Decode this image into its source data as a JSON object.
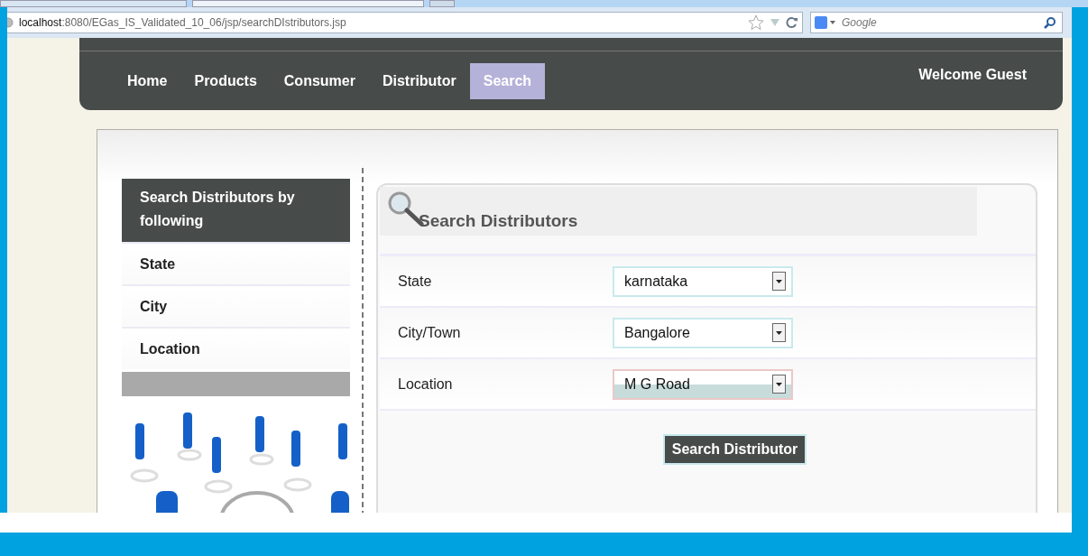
{
  "browser": {
    "url_host": "localhost",
    "url_path": ":8080/EGas_IS_Validated_10_06/jsp/searchDIstributors.jsp",
    "search_placeholder": "Google"
  },
  "nav": {
    "items": [
      {
        "label": "Home",
        "selected": false
      },
      {
        "label": "Products",
        "selected": false
      },
      {
        "label": "Consumer",
        "selected": false
      },
      {
        "label": "Distributor",
        "selected": false
      },
      {
        "label": "Search",
        "selected": true
      }
    ],
    "welcome": "Welcome Guest"
  },
  "sidebar": {
    "title": "Search Distributors by following",
    "items": [
      "State",
      "City",
      "Location"
    ]
  },
  "form": {
    "title": "Search Distributors",
    "fields": [
      {
        "label": "State",
        "value": "karnataka",
        "highlighted": false
      },
      {
        "label": "City/Town",
        "value": "Bangalore",
        "highlighted": false
      },
      {
        "label": "Location",
        "value": "M G Road",
        "highlighted": true
      }
    ],
    "button": "Search Distributor"
  }
}
